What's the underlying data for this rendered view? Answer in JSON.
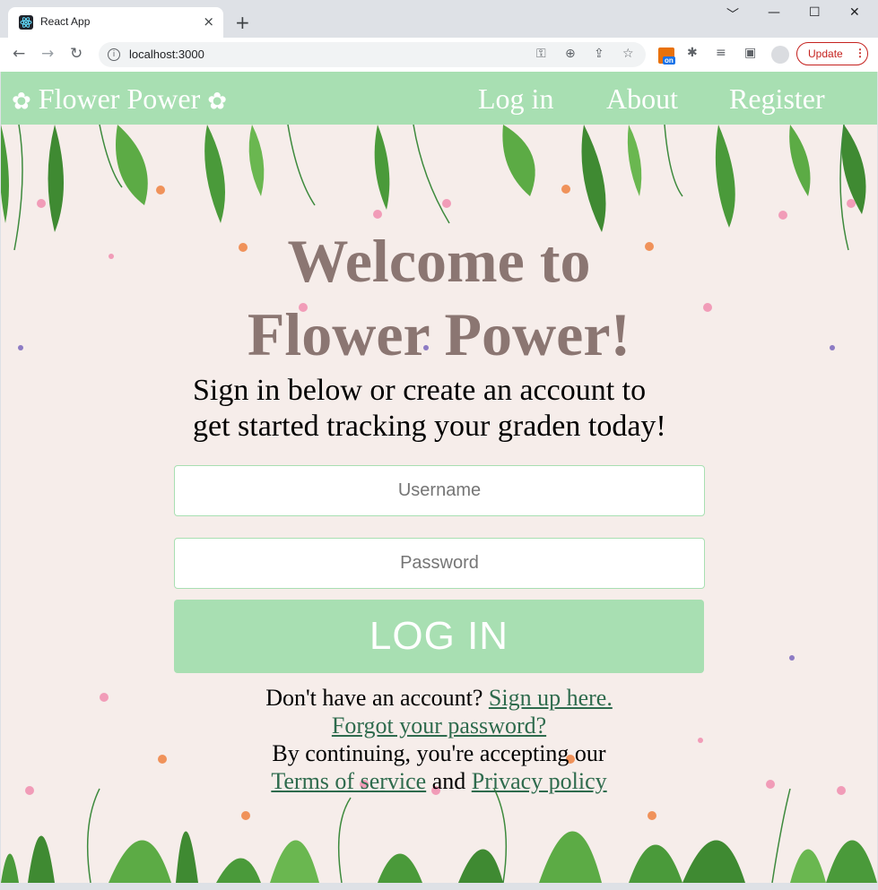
{
  "browser": {
    "tab_title": "React App",
    "tab_close": "×",
    "new_tab": "+",
    "url": "localhost:3000",
    "update_label": "Update",
    "window_controls": [
      "﹀",
      "—",
      "☐",
      "✕"
    ]
  },
  "navbar": {
    "brand": "Flower Power",
    "links": [
      "Log in",
      "About",
      "Register"
    ],
    "background": "#a8dfb2"
  },
  "main": {
    "title_line1": "Welcome to",
    "title_line2": "Flower Power!",
    "subtitle_line1": "Sign in below or create an account to",
    "subtitle_line2": "get started tracking your graden today!",
    "username_placeholder": "Username",
    "password_placeholder": "Password",
    "login_button": "LOG IN",
    "signup_prompt": "Don't have an account?",
    "signup_link": "Sign up here.",
    "forgot_link": "Forgot your password?",
    "terms_prompt": "By continuing, you're accepting our",
    "terms_link": "Terms of service",
    "and_text": "and",
    "privacy_link": "Privacy policy"
  },
  "colors": {
    "accent": "#a8dfb2",
    "title": "#8b7672",
    "link": "#2e6b4d",
    "page_bg": "#f6edea"
  }
}
